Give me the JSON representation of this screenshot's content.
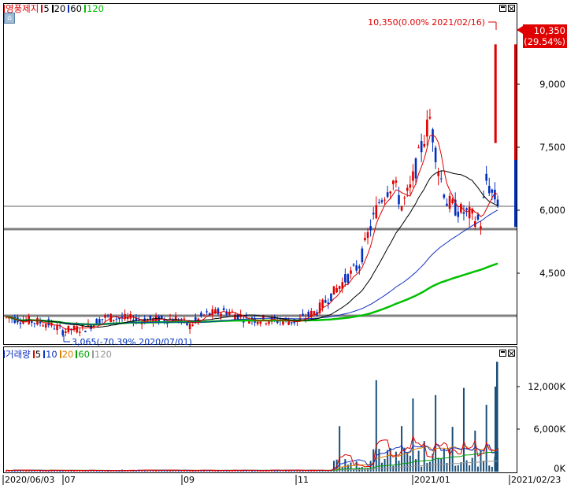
{
  "price_panel": {
    "legend": {
      "stock_name": "영풍제지",
      "ma": [
        {
          "label": "5",
          "color": "#e00000"
        },
        {
          "label": "20",
          "color": "#000000"
        },
        {
          "label": "60",
          "color": "#1030c0"
        },
        {
          "label": "120",
          "color": "#00c000"
        }
      ]
    },
    "y_ticks": [
      "9,000",
      "7,500",
      "6,000",
      "4,500"
    ],
    "current_price_label": "10,350",
    "current_change_label": "(29.54%)",
    "high_annotation": "10,350(0.00% 2021/02/16)",
    "low_annotation": "3,065(-70.39% 2020/07/01)"
  },
  "volume_panel": {
    "legend": {
      "title": "거래량",
      "ma": [
        {
          "label": "5",
          "color": "#e00000"
        },
        {
          "label": "10",
          "color": "#1030c0"
        },
        {
          "label": "20",
          "color": "#e08000"
        },
        {
          "label": "60",
          "color": "#00a000"
        },
        {
          "label": "120",
          "color": "#999999"
        }
      ]
    },
    "y_ticks": [
      "12,000K",
      "6,000K",
      "0K"
    ]
  },
  "x_axis": {
    "labels": [
      "2020/06/03",
      "07",
      "09",
      "11",
      "2021/01",
      "2021/02/23"
    ]
  },
  "colors": {
    "up": "#e00000",
    "down": "#0030c0",
    "ma5": "#e00000",
    "ma20": "#000000",
    "ma60": "#1030c0",
    "ma120": "#00c000"
  }
}
